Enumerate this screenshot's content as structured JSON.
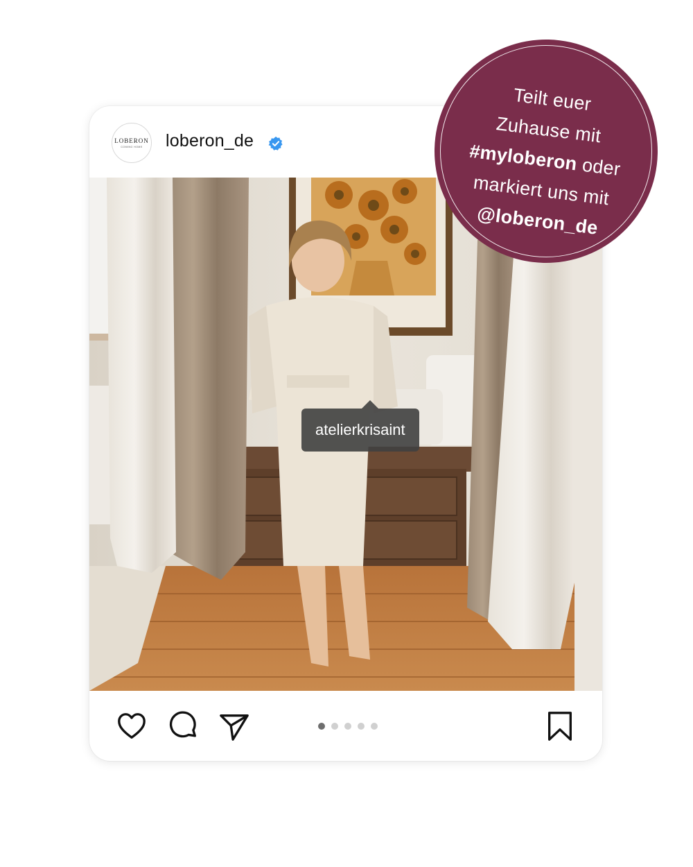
{
  "post": {
    "username": "loberon_de",
    "verified": true,
    "avatar": {
      "brand": "LOBERON",
      "tagline": "COMING HOME"
    },
    "photo_tag": "atelierkrisaint",
    "carousel": {
      "total": 5,
      "active": 1
    }
  },
  "actions": {
    "like_icon": "heart-icon",
    "comment_icon": "comment-icon",
    "share_icon": "send-icon",
    "save_icon": "bookmark-icon"
  },
  "promo": {
    "line1": "Teilt euer",
    "line2": "Zuhause mit",
    "hashtag": "#myloberon",
    "line3_rest": " oder",
    "line4": "markiert uns mit",
    "handle": "@loberon_de"
  },
  "colors": {
    "badge": "#7a2d4b",
    "verified": "#3897f0",
    "tag_bg": "#404040"
  }
}
